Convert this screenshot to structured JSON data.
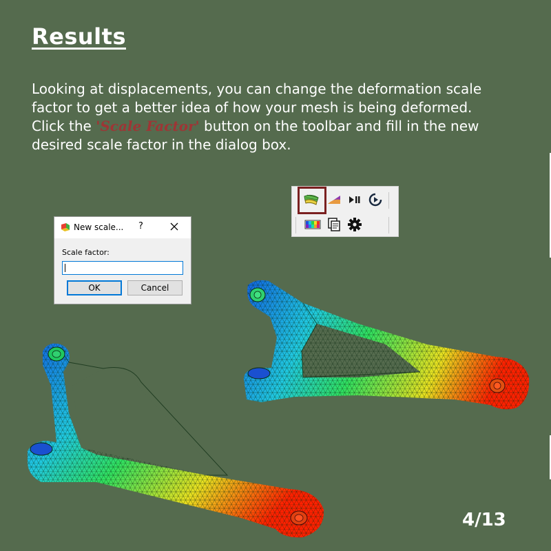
{
  "slide": {
    "title": "Results",
    "paragraph": {
      "before": "Looking at displacements, you can change the deformation scale factor to get a better idea of how your mesh is being deformed. Click the ",
      "highlight": "'Scale Factor'",
      "after": " button on the toolbar and fill in the new desired scale factor in the dialog box."
    },
    "page_indicator": "4/13"
  },
  "toolbar": {
    "buttons_row1": [
      "scale-factor-icon",
      "color-ramp-icon",
      "play-pause-icon",
      "clock-play-icon"
    ],
    "buttons_row2": [
      "color-map-icon",
      "copy-icon",
      "gear-icon"
    ],
    "highlight_color": "#7a2020"
  },
  "dialog": {
    "title": "New scale...",
    "help": "?",
    "field_label": "Scale factor:",
    "field_value": "",
    "ok_label": "OK",
    "cancel_label": "Cancel"
  },
  "colors": {
    "background": "#556b4e",
    "highlight_text": "#9e3535",
    "mesh_low": "#1060e0",
    "mesh_mid": "#20e060",
    "mesh_high": "#ff2000"
  }
}
